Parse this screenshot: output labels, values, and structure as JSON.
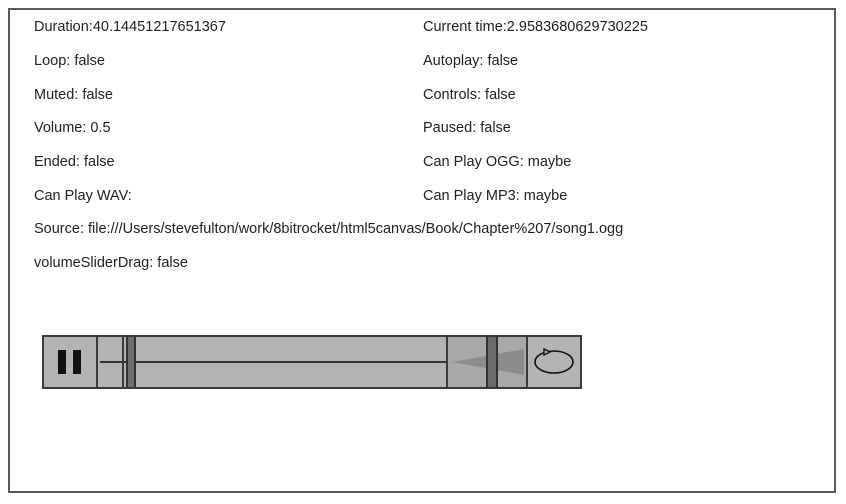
{
  "status": {
    "duration": "Duration:40.14451217651367",
    "current_time": "Current time:2.9583680629730225",
    "loop": "Loop: false",
    "autoplay": "Autoplay: false",
    "muted": "Muted: false",
    "controls": "Controls: false",
    "volume": "Volume: 0.5",
    "paused": "Paused: false",
    "ended": "Ended: false",
    "can_play_ogg": "Can Play OGG: maybe",
    "can_play_wav": "Can Play WAV:",
    "can_play_mp3": "Can Play MP3: maybe",
    "source": "Source: file:///Users/stevefulton/work/8bitrocket/html5canvas/Book/Chapter%207/song1.ogg",
    "volume_slider_drag": "volumeSliderDrag: false"
  },
  "player": {
    "play_button_icon": "pause-icon",
    "loop_button_icon": "loop-icon",
    "playback_progress": 0.0737,
    "volume_level": 0.5,
    "colors": {
      "control_bg": "#b3b3b3",
      "thumb": "#6e6e6e",
      "border": "#3a3a3a",
      "volume_wedge": "#8c8c8c"
    }
  }
}
